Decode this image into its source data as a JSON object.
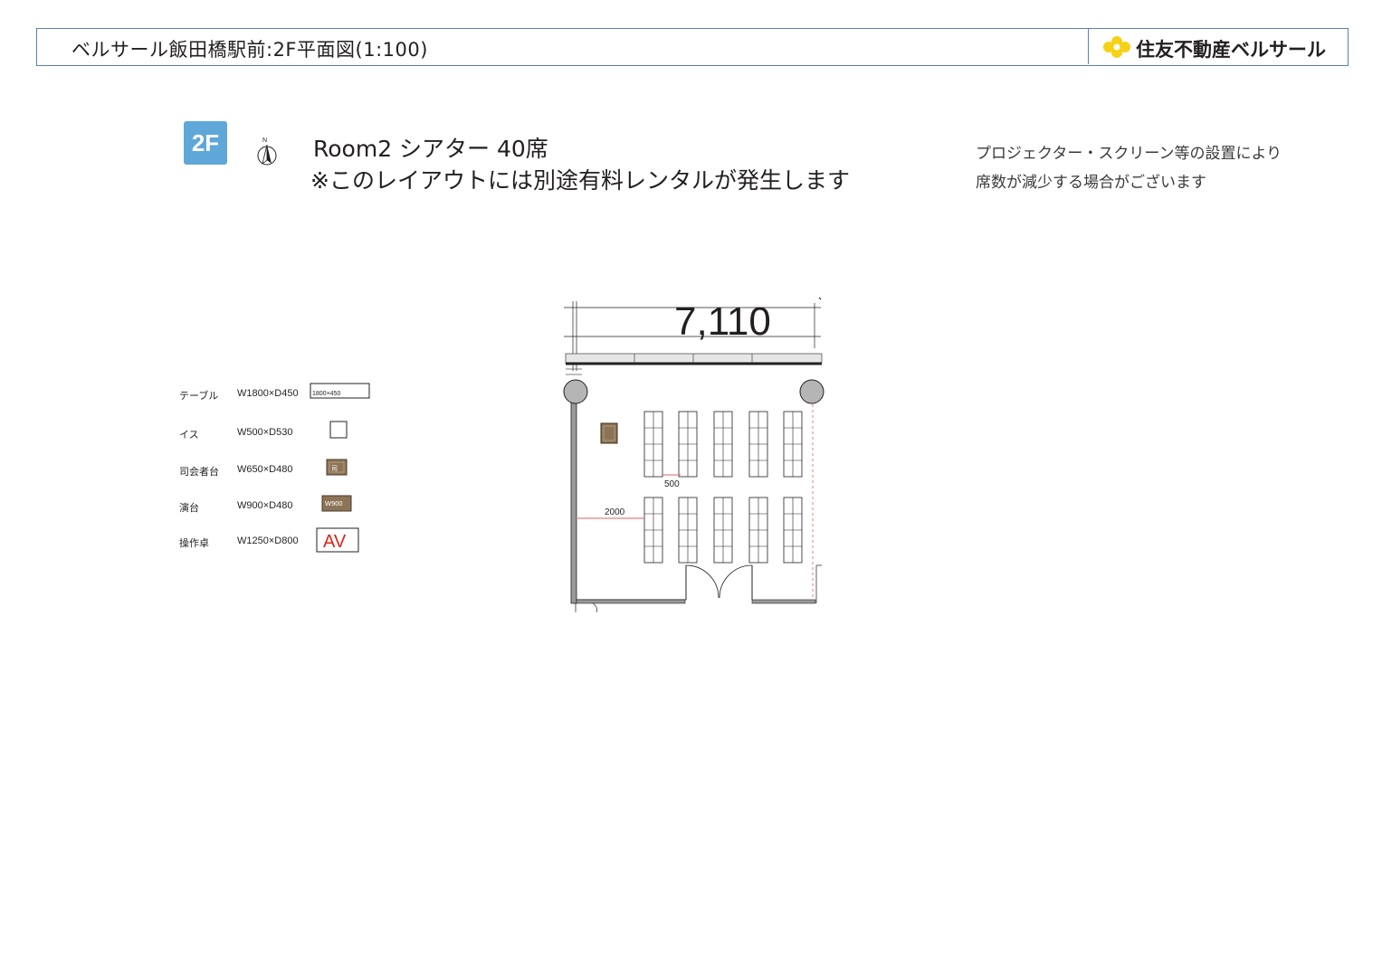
{
  "header": {
    "title": "ベルサール飯田橋駅前:2F平面図(1:100)",
    "brand": "住友不動産ベルサール",
    "brand_logo_color": "#f7d117",
    "border_color": "#5b7fb3"
  },
  "floor_badge": {
    "label": "2F",
    "color": "#5fa7d8"
  },
  "compass": {
    "label": "N",
    "icon": "north-arrow-icon"
  },
  "room": {
    "title": "Room2 シアター 40席",
    "note": "※このレイアウトには別途有料レンタルが発生します"
  },
  "side_note": {
    "line1": "プロジェクター・スクリーン等の設置により",
    "line2": "席数が減少する場合がございます"
  },
  "legend": [
    {
      "name": "テーブル",
      "size": "W1800×D450",
      "symbol_label": "1800×450"
    },
    {
      "name": "イス",
      "size": "W500×D530",
      "symbol_label": ""
    },
    {
      "name": "司会者台",
      "size": "W650×D480",
      "symbol_label": "司"
    },
    {
      "name": "演台",
      "size": "W900×D480",
      "symbol_label": "W900"
    },
    {
      "name": "操作卓",
      "size": "W1250×D800",
      "symbol_label": "AV"
    }
  ],
  "plan": {
    "width_dimension": "7,110",
    "aisle_label": "500",
    "front_gap_label": "2000",
    "tables": {
      "columns": 5,
      "blocks": 2,
      "chairs_per_column": 4,
      "total_seats": 40
    }
  }
}
